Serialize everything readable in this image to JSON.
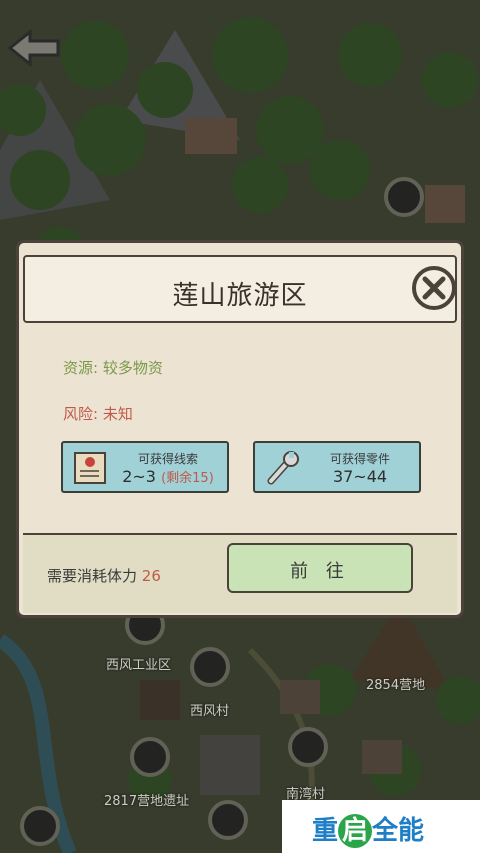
{
  "map": {
    "labels": {
      "xifeng_industrial": "西风工业区",
      "xifeng_village": "西风村",
      "camp_2817": "2817营地遗址",
      "camp_2854": "2854营地",
      "nanwan_village": "南湾村"
    }
  },
  "dialog": {
    "title": "莲山旅游区",
    "resource": "资源: 较多物资",
    "risk": "风险: 未知",
    "clues_card": {
      "label": "可获得线索",
      "value": "2~3",
      "remaining": "(剩余15)"
    },
    "parts_card": {
      "label": "可获得零件",
      "value": "37~44"
    },
    "cost_label": "需要消耗体力",
    "cost_value": "26",
    "go_button": "前 往"
  },
  "watermark": {
    "text_left": "重",
    "text_mid": "启",
    "text_right": "全能"
  },
  "colors": {
    "resource": "#7a9a4a",
    "risk": "#c05a4a",
    "card_bg": "#9fd1d7",
    "go_bg": "#c9e3b6"
  }
}
